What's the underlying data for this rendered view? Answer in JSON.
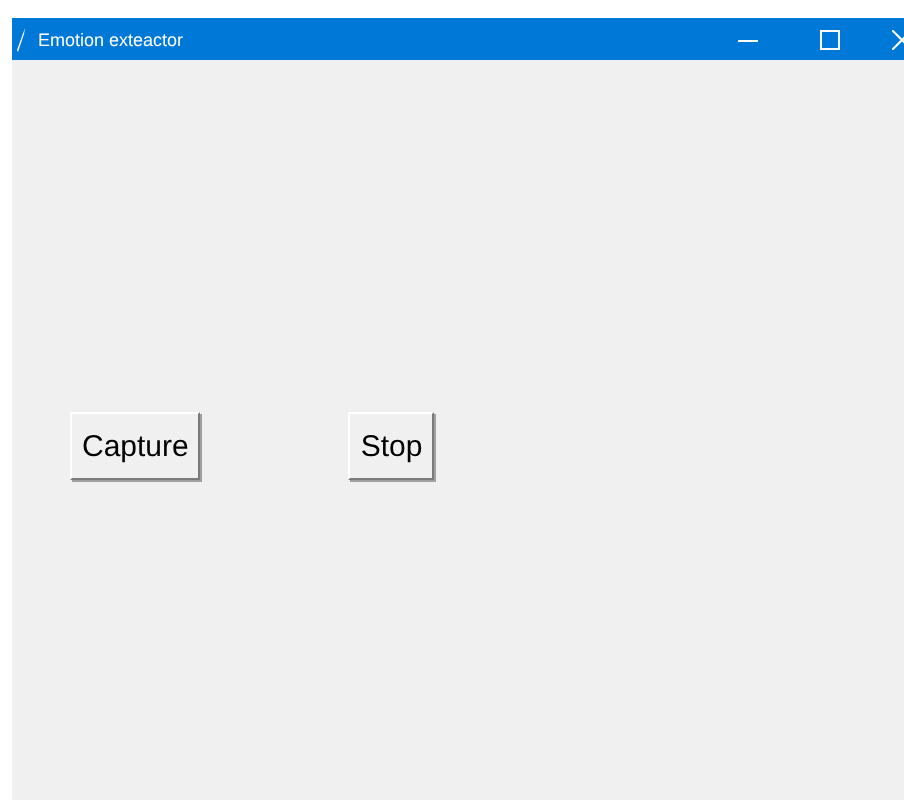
{
  "window": {
    "title": "Emotion exteactor"
  },
  "buttons": [
    {
      "label": "Capture"
    },
    {
      "label": "Stop"
    }
  ]
}
